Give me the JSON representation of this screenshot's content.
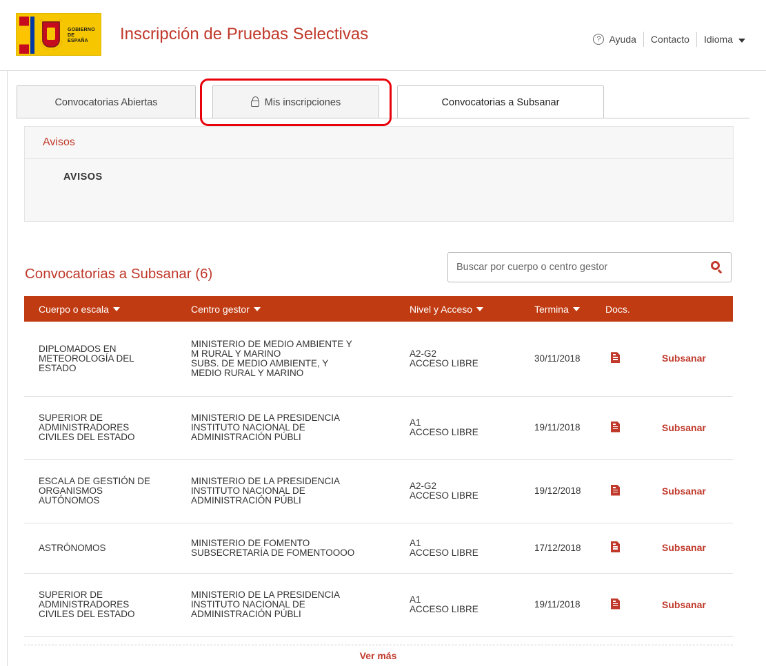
{
  "header": {
    "logo_text": [
      "GOBIERNO",
      "DE ESPAÑA"
    ],
    "app_title": "Inscripción de Pruebas Selectivas",
    "nav": {
      "help_icon": "?",
      "help": "Ayuda",
      "contact": "Contacto",
      "language": "Idioma"
    }
  },
  "tabs": [
    {
      "label": "Convocatorias Abiertas",
      "active": false
    },
    {
      "label": "Mis inscripciones",
      "active": false,
      "icon": "lock-icon"
    },
    {
      "label": "Convocatorias a Subsanar",
      "active": true
    }
  ],
  "avisos": {
    "heading": "Avisos",
    "body": "AVISOS"
  },
  "section_title": "Convocatorias a Subsanar (6)",
  "search": {
    "placeholder": "Buscar por cuerpo o centro gestor",
    "value": ""
  },
  "table": {
    "columns": [
      "Cuerpo o escala",
      "Centro gestor",
      "Nivel y Acceso",
      "Termina",
      "Docs.",
      ""
    ],
    "rows": [
      {
        "cuerpo": [
          "DIPLOMADOS EN",
          "METEOROLOGÍA DEL",
          "ESTADO"
        ],
        "centro": [
          "MINISTERIO DE MEDIO AMBIENTE Y",
          "M RURAL Y MARINO",
          "SUBS. DE MEDIO AMBIENTE, Y",
          "MEDIO RURAL Y MARINO"
        ],
        "nivel": [
          "A2-G2",
          "ACCESO LIBRE"
        ],
        "termina": "30/11/2018",
        "action": "Subsanar"
      },
      {
        "cuerpo": [
          "SUPERIOR DE",
          "ADMINISTRADORES",
          "CIVILES DEL ESTADO"
        ],
        "centro": [
          "MINISTERIO DE LA PRESIDENCIA",
          "INSTITUTO NACIONAL DE",
          "ADMINISTRACIÓN PÚBLI"
        ],
        "nivel": [
          "A1",
          "ACCESO LIBRE"
        ],
        "termina": "19/11/2018",
        "action": "Subsanar"
      },
      {
        "cuerpo": [
          "ESCALA DE GESTIÓN DE",
          "ORGANISMOS",
          "AUTÓNOMOS"
        ],
        "centro": [
          "MINISTERIO DE LA PRESIDENCIA",
          "INSTITUTO NACIONAL DE",
          "ADMINISTRACIÓN PÚBLI"
        ],
        "nivel": [
          "A2-G2",
          "ACCESO LIBRE"
        ],
        "termina": "19/12/2018",
        "action": "Subsanar"
      },
      {
        "cuerpo": [
          "ASTRÓNOMOS"
        ],
        "centro": [
          "MINISTERIO DE FOMENTO",
          "SUBSECRETARÍA DE FOMENTOOOO"
        ],
        "nivel": [
          "A1",
          "ACCESO LIBRE"
        ],
        "termina": "17/12/2018",
        "action": "Subsanar"
      },
      {
        "cuerpo": [
          "SUPERIOR DE",
          "ADMINISTRADORES",
          "CIVILES DEL ESTADO"
        ],
        "centro": [
          "MINISTERIO DE LA PRESIDENCIA",
          "INSTITUTO NACIONAL DE",
          "ADMINISTRACIÓN PÚBLI"
        ],
        "nivel": [
          "A1",
          "ACCESO LIBRE"
        ],
        "termina": "19/11/2018",
        "action": "Subsanar"
      }
    ]
  },
  "ver_mas": "Ver más",
  "colors": {
    "accent": "#c0392b",
    "table_header": "#c03b12",
    "highlight": "#e8000b"
  }
}
